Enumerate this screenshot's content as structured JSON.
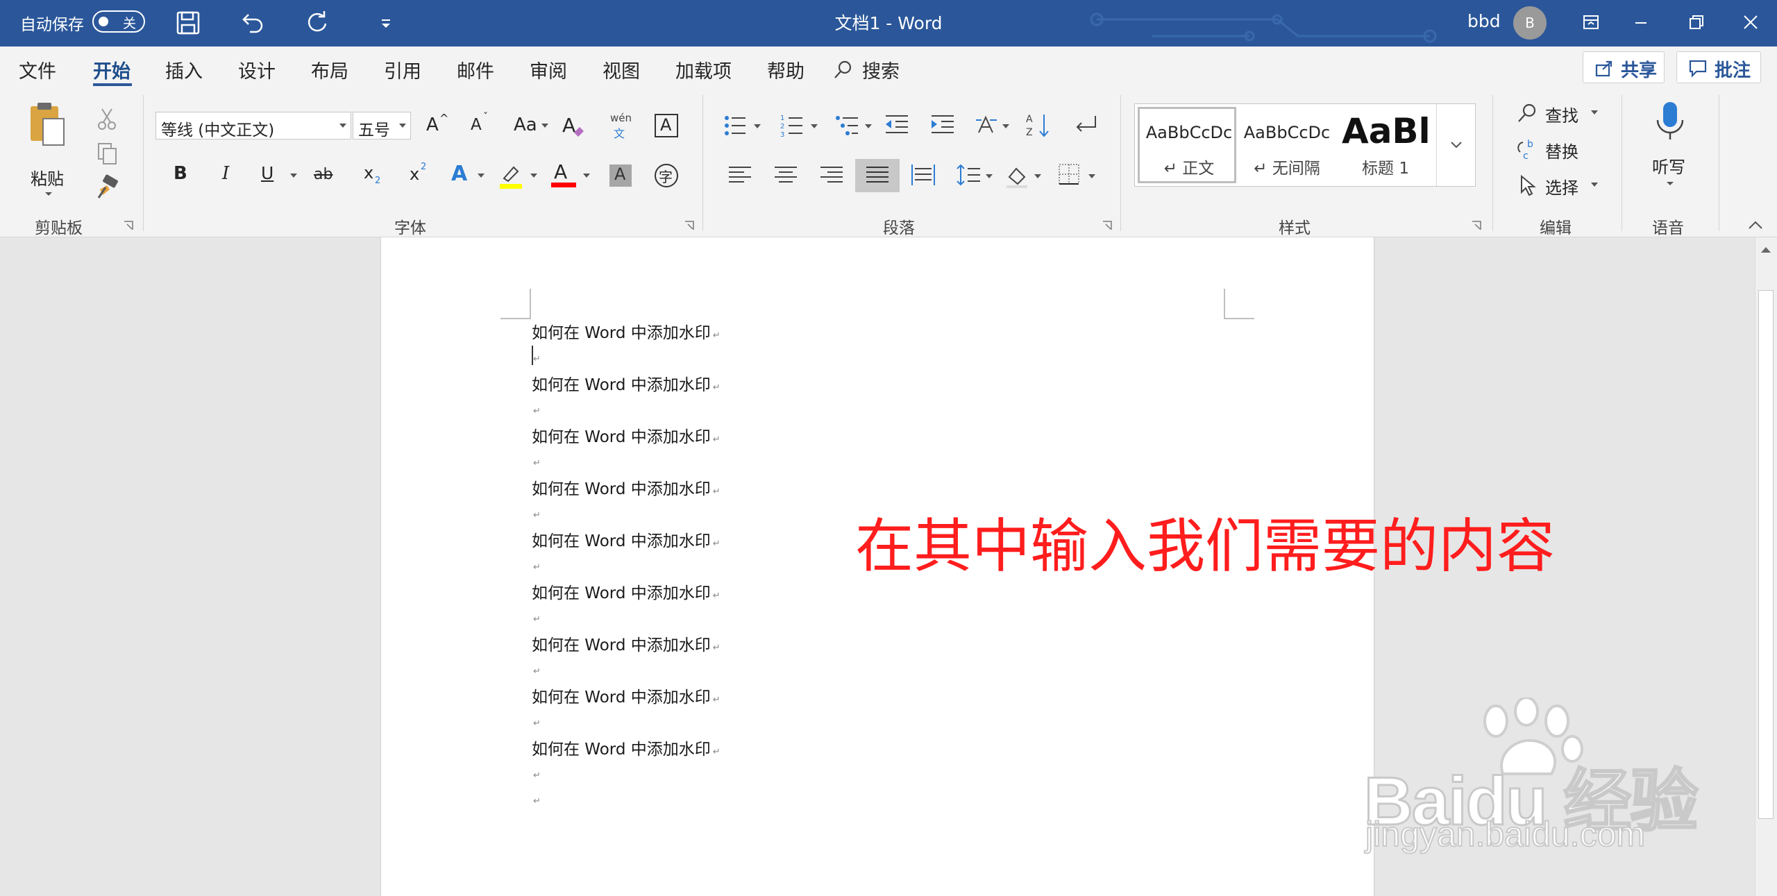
{
  "titlebar": {
    "autosave_label": "自动保存",
    "autosave_state": "关",
    "doc_title": "文档1  -  Word",
    "user_name": "bbd",
    "avatar_initial": "B"
  },
  "tabs": [
    {
      "label": "文件"
    },
    {
      "label": "开始"
    },
    {
      "label": "插入"
    },
    {
      "label": "设计"
    },
    {
      "label": "布局"
    },
    {
      "label": "引用"
    },
    {
      "label": "邮件"
    },
    {
      "label": "审阅"
    },
    {
      "label": "视图"
    },
    {
      "label": "加载项"
    },
    {
      "label": "帮助"
    },
    {
      "label": "搜索"
    }
  ],
  "tab_actions": {
    "share": "共享",
    "comments": "批注"
  },
  "ribbon": {
    "clipboard": {
      "paste_label": "粘贴",
      "group_label": "剪贴板"
    },
    "font": {
      "font_name": "等线 (中文正文)",
      "font_size": "五号",
      "phonetic_top": "wén",
      "phonetic_bottom": "文",
      "char_border": "A",
      "group_label": "字体",
      "bold": "B",
      "italic": "I",
      "underline": "U",
      "strike": "ab",
      "subscript": "x",
      "subscript_mark": "2",
      "superscript": "x",
      "superscript_mark": "2",
      "text_effects": "A",
      "font_color": "A",
      "char_shading": "A",
      "enclose_char": "字",
      "grow": "A",
      "shrink": "A",
      "change_case": "Aa",
      "clear_format": "A"
    },
    "paragraph": {
      "group_label": "段落"
    },
    "styles": {
      "group_label": "样式",
      "items": [
        {
          "preview": "AaBbCcDc",
          "name": "↵ 正文"
        },
        {
          "preview": "AaBbCcDc",
          "name": "↵ 无间隔"
        },
        {
          "preview": "AaBl",
          "name": "标题 1"
        }
      ]
    },
    "editing": {
      "find": "查找",
      "replace": "替换",
      "select": "选择",
      "group_label": "编辑"
    },
    "voice": {
      "dictate": "听写",
      "group_label": "语音"
    }
  },
  "colors": {
    "titlebar": "#2b579a",
    "highlight": "#ffff00",
    "font_color": "#ff0000",
    "annotation": "#ff1d1d"
  },
  "document": {
    "paragraphs": [
      "如何在 Word 中添加水印",
      "",
      "如何在 Word 中添加水印",
      "",
      "如何在 Word 中添加水印",
      "",
      "如何在 Word 中添加水印",
      "",
      "如何在 Word 中添加水印",
      "",
      "如何在 Word 中添加水印",
      "",
      "如何在 Word 中添加水印",
      "",
      "如何在 Word 中添加水印",
      "",
      "如何在 Word 中添加水印",
      "",
      ""
    ],
    "paragraph_mark": "↵"
  },
  "annotation": "在其中输入我们需要的内容",
  "watermark": {
    "logo": "Bai du 经验",
    "url": "jingyan.baidu.com"
  }
}
